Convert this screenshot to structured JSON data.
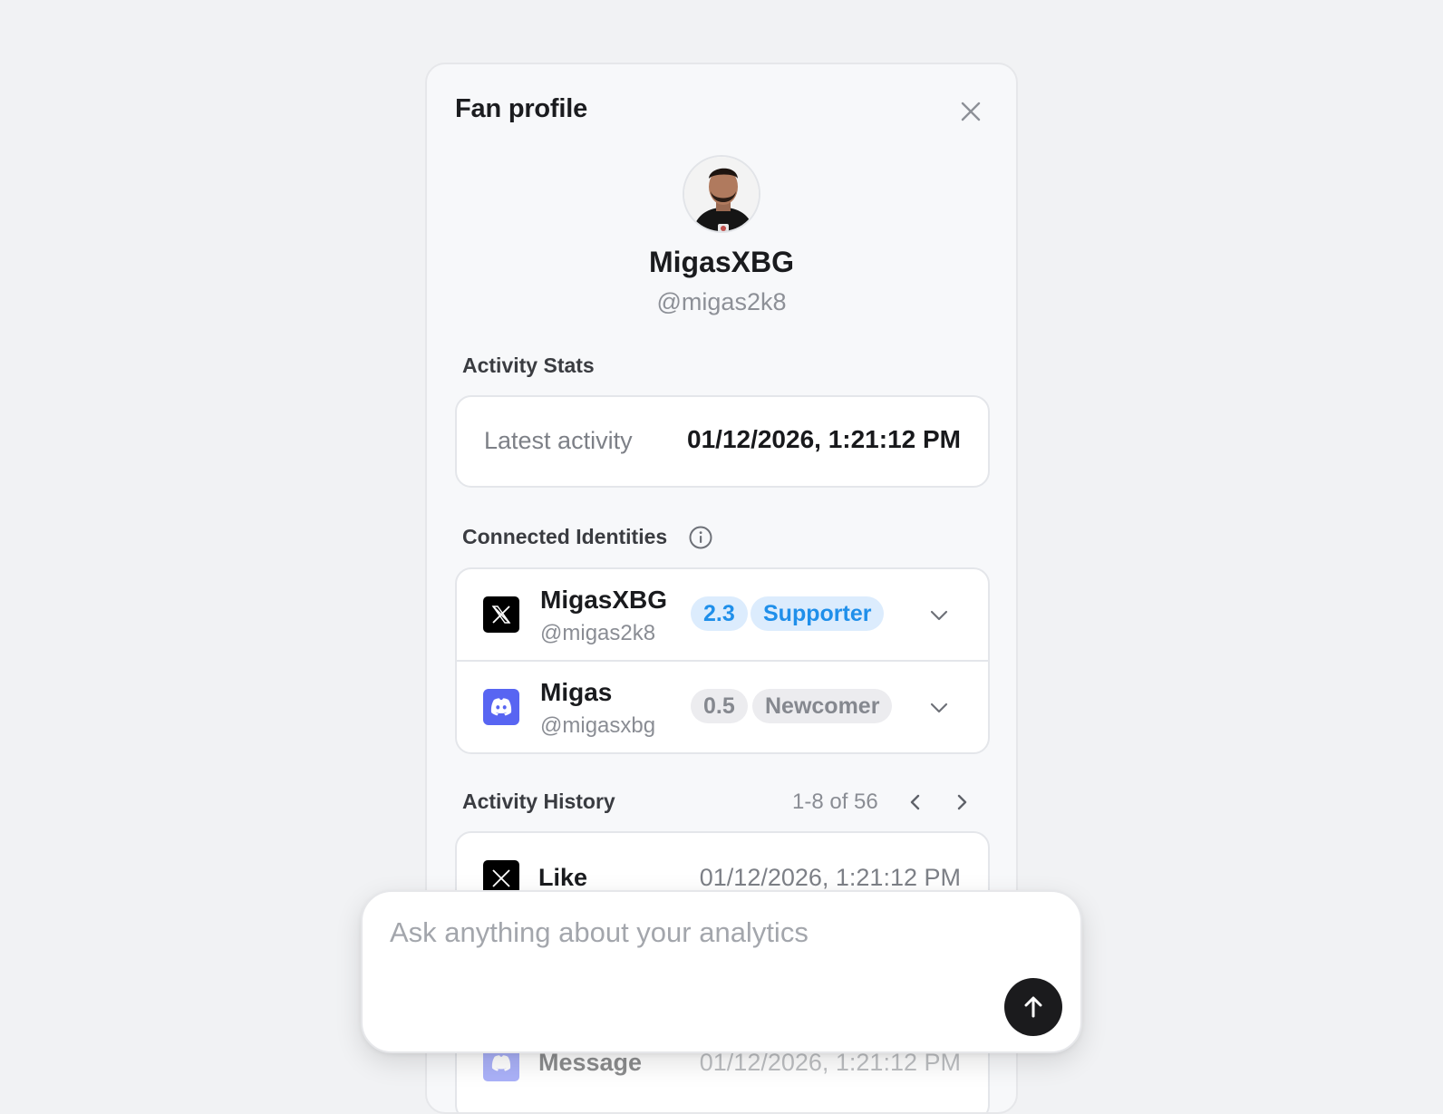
{
  "panel": {
    "title": "Fan profile",
    "close_icon": "close-icon"
  },
  "profile": {
    "name": "MigasXBG",
    "handle": "@migas2k8",
    "avatar_icon": "avatar"
  },
  "activity_stats": {
    "label": "Activity Stats",
    "latest_label": "Latest activity",
    "latest_value": "01/12/2026, 1:21:12 PM"
  },
  "identities": {
    "label": "Connected Identities",
    "info_icon": "info-icon",
    "items": [
      {
        "platform": "x-icon",
        "name": "MigasXBG",
        "handle": "@migas2k8",
        "score": "2.3",
        "tier": "Supporter",
        "tier_color": "#1f8fea"
      },
      {
        "platform": "discord-icon",
        "name": "Migas",
        "handle": "@migasxbg",
        "score": "0.5",
        "tier": "Newcomer",
        "tier_color": "#85888f"
      }
    ]
  },
  "history": {
    "label": "Activity History",
    "range": "1-8 of 56",
    "rows": [
      {
        "platform": "x-icon",
        "type": "Like",
        "time": "01/12/2026, 1:21:12 PM"
      },
      {
        "platform": "discord-icon",
        "type": "Message",
        "time": "01/12/2026, 1:21:12 PM"
      }
    ]
  },
  "chat": {
    "placeholder": "Ask anything about your analytics",
    "send_icon": "arrow-up-icon"
  }
}
